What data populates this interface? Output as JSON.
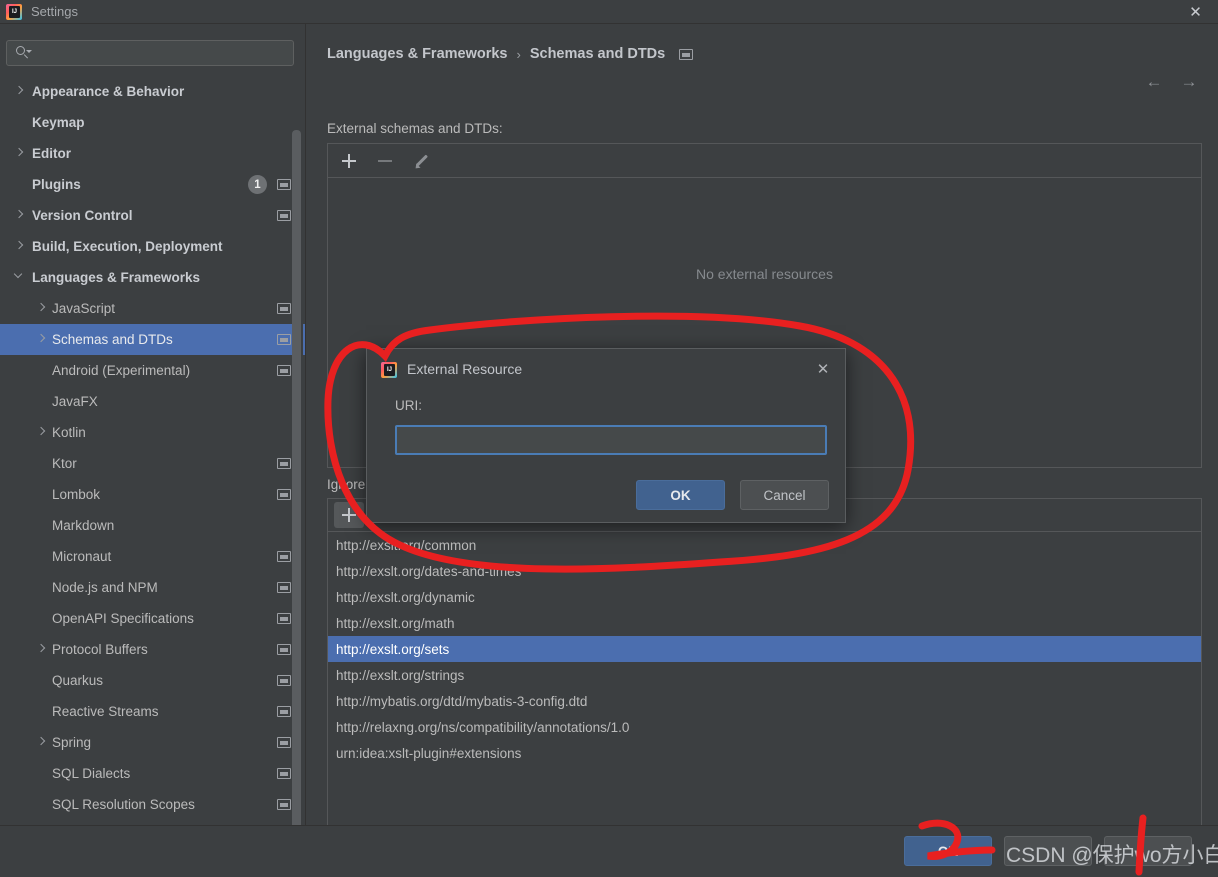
{
  "window": {
    "title": "Settings",
    "app_icon": "intellij-idea-icon",
    "close_label": "✕"
  },
  "sidebar": {
    "search": {
      "placeholder": "",
      "value": "",
      "icon": "search-icon"
    },
    "items": [
      {
        "label": "Appearance & Behavior",
        "indent": 0,
        "arrow": "right",
        "bold": true,
        "badge": null,
        "win_icon": false,
        "selected": false
      },
      {
        "label": "Keymap",
        "indent": 0,
        "arrow": null,
        "bold": true,
        "badge": null,
        "win_icon": false,
        "selected": false
      },
      {
        "label": "Editor",
        "indent": 0,
        "arrow": "right",
        "bold": true,
        "badge": null,
        "win_icon": false,
        "selected": false
      },
      {
        "label": "Plugins",
        "indent": 0,
        "arrow": null,
        "bold": true,
        "badge": "1",
        "win_icon": true,
        "selected": false
      },
      {
        "label": "Version Control",
        "indent": 0,
        "arrow": "right",
        "bold": true,
        "badge": null,
        "win_icon": true,
        "selected": false
      },
      {
        "label": "Build, Execution, Deployment",
        "indent": 0,
        "arrow": "right",
        "bold": true,
        "badge": null,
        "win_icon": false,
        "selected": false
      },
      {
        "label": "Languages & Frameworks",
        "indent": 0,
        "arrow": "down",
        "bold": true,
        "badge": null,
        "win_icon": false,
        "selected": false
      },
      {
        "label": "JavaScript",
        "indent": 1,
        "arrow": "right",
        "bold": false,
        "badge": null,
        "win_icon": true,
        "selected": false
      },
      {
        "label": "Schemas and DTDs",
        "indent": 1,
        "arrow": "right",
        "bold": false,
        "badge": null,
        "win_icon": true,
        "selected": true
      },
      {
        "label": "Android (Experimental)",
        "indent": 1,
        "arrow": null,
        "bold": false,
        "badge": null,
        "win_icon": true,
        "selected": false
      },
      {
        "label": "JavaFX",
        "indent": 1,
        "arrow": null,
        "bold": false,
        "badge": null,
        "win_icon": false,
        "selected": false
      },
      {
        "label": "Kotlin",
        "indent": 1,
        "arrow": "right",
        "bold": false,
        "badge": null,
        "win_icon": false,
        "selected": false
      },
      {
        "label": "Ktor",
        "indent": 1,
        "arrow": null,
        "bold": false,
        "badge": null,
        "win_icon": true,
        "selected": false
      },
      {
        "label": "Lombok",
        "indent": 1,
        "arrow": null,
        "bold": false,
        "badge": null,
        "win_icon": true,
        "selected": false
      },
      {
        "label": "Markdown",
        "indent": 1,
        "arrow": null,
        "bold": false,
        "badge": null,
        "win_icon": false,
        "selected": false
      },
      {
        "label": "Micronaut",
        "indent": 1,
        "arrow": null,
        "bold": false,
        "badge": null,
        "win_icon": true,
        "selected": false
      },
      {
        "label": "Node.js and NPM",
        "indent": 1,
        "arrow": null,
        "bold": false,
        "badge": null,
        "win_icon": true,
        "selected": false
      },
      {
        "label": "OpenAPI Specifications",
        "indent": 1,
        "arrow": null,
        "bold": false,
        "badge": null,
        "win_icon": true,
        "selected": false
      },
      {
        "label": "Protocol Buffers",
        "indent": 1,
        "arrow": "right",
        "bold": false,
        "badge": null,
        "win_icon": true,
        "selected": false
      },
      {
        "label": "Quarkus",
        "indent": 1,
        "arrow": null,
        "bold": false,
        "badge": null,
        "win_icon": true,
        "selected": false
      },
      {
        "label": "Reactive Streams",
        "indent": 1,
        "arrow": null,
        "bold": false,
        "badge": null,
        "win_icon": true,
        "selected": false
      },
      {
        "label": "Spring",
        "indent": 1,
        "arrow": "right",
        "bold": false,
        "badge": null,
        "win_icon": true,
        "selected": false
      },
      {
        "label": "SQL Dialects",
        "indent": 1,
        "arrow": null,
        "bold": false,
        "badge": null,
        "win_icon": true,
        "selected": false
      },
      {
        "label": "SQL Resolution Scopes",
        "indent": 1,
        "arrow": null,
        "bold": false,
        "badge": null,
        "win_icon": true,
        "selected": false
      }
    ],
    "help_label": "?"
  },
  "main": {
    "breadcrumb": {
      "root": "Languages & Frameworks",
      "separator": "›",
      "current": "Schemas and DTDs"
    },
    "nav": {
      "back": "←",
      "forward": "→"
    },
    "external": {
      "label": "External schemas and DTDs:",
      "toolbar": {
        "add": "+",
        "remove": "−",
        "edit": "pencil-icon"
      },
      "empty_text": "No external resources"
    },
    "ignored": {
      "label": "Ignore",
      "toolbar": {
        "add": "+"
      },
      "rows": [
        {
          "uri": "http://exslt.org/common",
          "selected": false
        },
        {
          "uri": "http://exslt.org/dates-and-times",
          "selected": false
        },
        {
          "uri": "http://exslt.org/dynamic",
          "selected": false
        },
        {
          "uri": "http://exslt.org/math",
          "selected": false
        },
        {
          "uri": "http://exslt.org/sets",
          "selected": true
        },
        {
          "uri": "http://exslt.org/strings",
          "selected": false
        },
        {
          "uri": "http://mybatis.org/dtd/mybatis-3-config.dtd",
          "selected": false
        },
        {
          "uri": "http://relaxng.org/ns/compatibility/annotations/1.0",
          "selected": false
        },
        {
          "uri": "urn:idea:xslt-plugin#extensions",
          "selected": false
        }
      ]
    }
  },
  "footer": {
    "ok": "OK",
    "cancel": "",
    "apply": ""
  },
  "modal": {
    "title": "External Resource",
    "icon": "intellij-idea-icon",
    "close_label": "✕",
    "uri_label": "URI:",
    "uri_value": "",
    "uri_placeholder": "",
    "ok": "OK",
    "cancel": "Cancel"
  },
  "watermark": {
    "text": "CSDN @保护wo方小白"
  },
  "colors": {
    "background": "#3c3f41",
    "selection": "#4b6eaf",
    "primary_button": "#41628f",
    "annotation_red": "#e82020",
    "text": "#bbbbbb",
    "border": "#555759"
  }
}
